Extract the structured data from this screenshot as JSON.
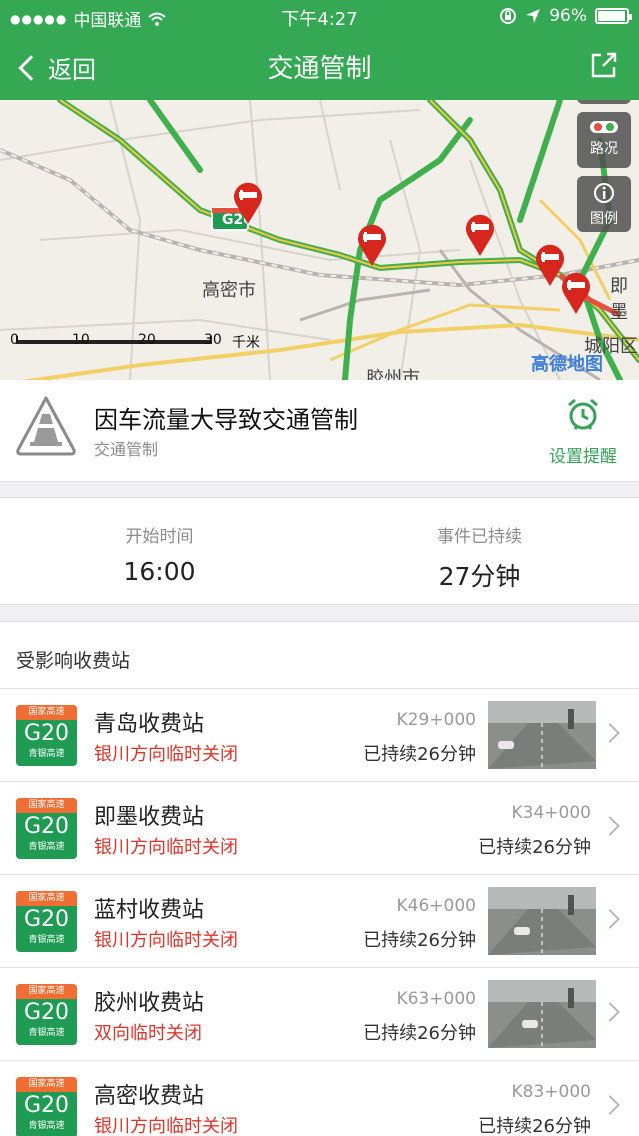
{
  "status_bar": {
    "carrier": "中国联通",
    "time": "下午4:27",
    "battery": "96%"
  },
  "nav": {
    "back_label": "返回",
    "title": "交通管制"
  },
  "map": {
    "city_labels": [
      "高密市",
      "胶州市",
      "城阳区",
      "即墨"
    ],
    "road_badge": "G20",
    "traffic_button": "路况",
    "legend_button": "图例",
    "scale_ticks": [
      "0",
      "10",
      "20",
      "30"
    ],
    "scale_unit": "千米",
    "brand": "高德地图"
  },
  "event": {
    "headline": "因车流量大导致交通管制",
    "category": "交通管制",
    "remind_label": "设置提醒"
  },
  "times": {
    "start_label": "开始时间",
    "start_value": "16:00",
    "duration_label": "事件已持续",
    "duration_value": "27分钟"
  },
  "stations": {
    "section_title": "受影响收费站",
    "shield": {
      "top": "国家高速",
      "code": "G20",
      "bottom": "青银高速"
    },
    "items": [
      {
        "name": "青岛收费站",
        "status": "银川方向临时关闭",
        "km": "K29+000",
        "duration": "已持续26分钟",
        "has_photo": true
      },
      {
        "name": "即墨收费站",
        "status": "银川方向临时关闭",
        "km": "K34+000",
        "duration": "已持续26分钟",
        "has_photo": false
      },
      {
        "name": "蓝村收费站",
        "status": "银川方向临时关闭",
        "km": "K46+000",
        "duration": "已持续26分钟",
        "has_photo": true
      },
      {
        "name": "胶州收费站",
        "status": "双向临时关闭",
        "km": "K63+000",
        "duration": "已持续26分钟",
        "has_photo": true
      },
      {
        "name": "高密收费站",
        "status": "银川方向临时关闭",
        "km": "K83+000",
        "duration": "已持续26分钟",
        "has_photo": false
      }
    ]
  },
  "colors": {
    "brand_green": "#34a853",
    "alert_red": "#e0342a",
    "shield_green": "#1f9b53",
    "shield_orange": "#f06d33"
  }
}
